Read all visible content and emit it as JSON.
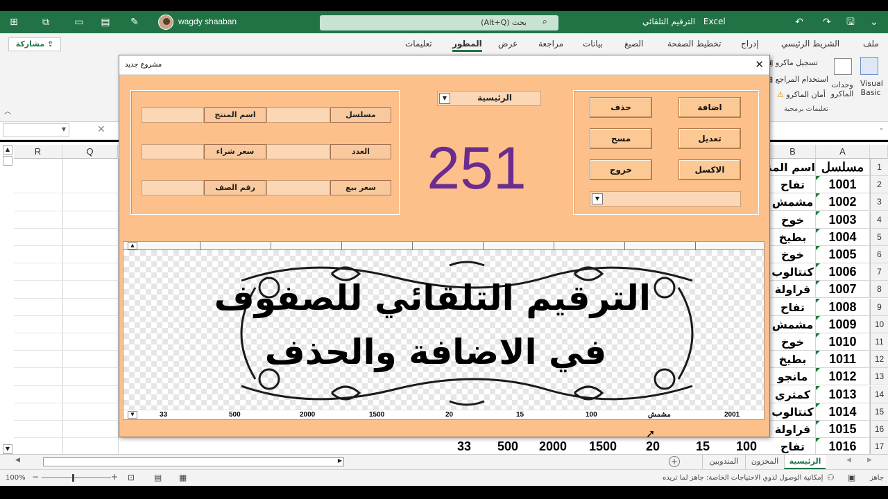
{
  "window": {
    "app_name": "Excel",
    "doc_title": "الترقيم التلقائي",
    "user": "wagdy shaaban",
    "search_placeholder": "بحث (Alt+Q)"
  },
  "ribbon": {
    "tabs": [
      "ملف",
      "الشريط الرئيسي",
      "إدراج",
      "تخطيط الصفحة",
      "الصيغ",
      "بيانات",
      "مراجعة",
      "عرض",
      "المطور",
      "تعليمات"
    ],
    "active_tab": "المطور",
    "share_label": "مشاركة",
    "visual_basic": "Visual Basic",
    "macros": "وحدات الماكرو",
    "record_macro": "تسجيل ماكرو",
    "use_relative": "استخدام المراجع",
    "macro_security": "أمان الماكرو",
    "group_label": "تعليمات برمجية"
  },
  "sheet": {
    "columns": [
      "A",
      "B",
      "Q",
      "R"
    ],
    "header_row": {
      "a": "مسلسل",
      "b": "اسم المنتج"
    },
    "rows": [
      {
        "n": "2",
        "a": "1001",
        "b": "تفاح"
      },
      {
        "n": "3",
        "a": "1002",
        "b": "مشمش"
      },
      {
        "n": "4",
        "a": "1003",
        "b": "خوخ"
      },
      {
        "n": "5",
        "a": "1004",
        "b": "بطيخ"
      },
      {
        "n": "6",
        "a": "1005",
        "b": "خوخ"
      },
      {
        "n": "7",
        "a": "1006",
        "b": "كنتالوب"
      },
      {
        "n": "8",
        "a": "1007",
        "b": "فراولة"
      },
      {
        "n": "9",
        "a": "1008",
        "b": "تفاح"
      },
      {
        "n": "10",
        "a": "1009",
        "b": "مشمش"
      },
      {
        "n": "11",
        "a": "1010",
        "b": "خوخ"
      },
      {
        "n": "12",
        "a": "1011",
        "b": "بطيخ"
      },
      {
        "n": "13",
        "a": "1012",
        "b": "مانجو"
      },
      {
        "n": "14",
        "a": "1013",
        "b": "كمثري"
      },
      {
        "n": "15",
        "a": "1014",
        "b": "كنتالوب"
      },
      {
        "n": "16",
        "a": "1015",
        "b": "فراولة"
      },
      {
        "n": "17",
        "a": "1016",
        "b": "تفاح"
      }
    ],
    "header_row_num": "1",
    "bottom_values": [
      "100",
      "15",
      "20",
      "1500",
      "2000",
      "500",
      "33"
    ]
  },
  "sheet_tabs": [
    "الرئيسية",
    "المخزون",
    "المندوبين"
  ],
  "active_sheet": "الرئيسية",
  "status": {
    "ready": "جاهز",
    "accessibility": "إمكانية الوصول لذوي الاحتياجات الخاصة: جاهز لما تريده",
    "zoom": "100%"
  },
  "form": {
    "caption": "مشروع جديد",
    "labels": {
      "serial": "مسلسل",
      "product_name": "اسم المنتج",
      "count": "العدد",
      "buy_price": "سعر شراء",
      "sell_price": "سعر بيع",
      "row_num": "رقم الصف"
    },
    "sheet_combo_value": "الرئيسية",
    "big_number": "251",
    "buttons": {
      "add": "اضافة",
      "delete": "حذف",
      "edit": "تعديل",
      "clear": "مسح",
      "excel": "الاكسل",
      "exit": "خروج"
    },
    "banner_line1": "الترقيم التلقائي للصفوف",
    "banner_line2": "في الاضافة والحذف",
    "list_row": [
      "2001",
      "مشمش",
      "100",
      "15",
      "20",
      "1500",
      "2000",
      "500",
      "33"
    ]
  }
}
